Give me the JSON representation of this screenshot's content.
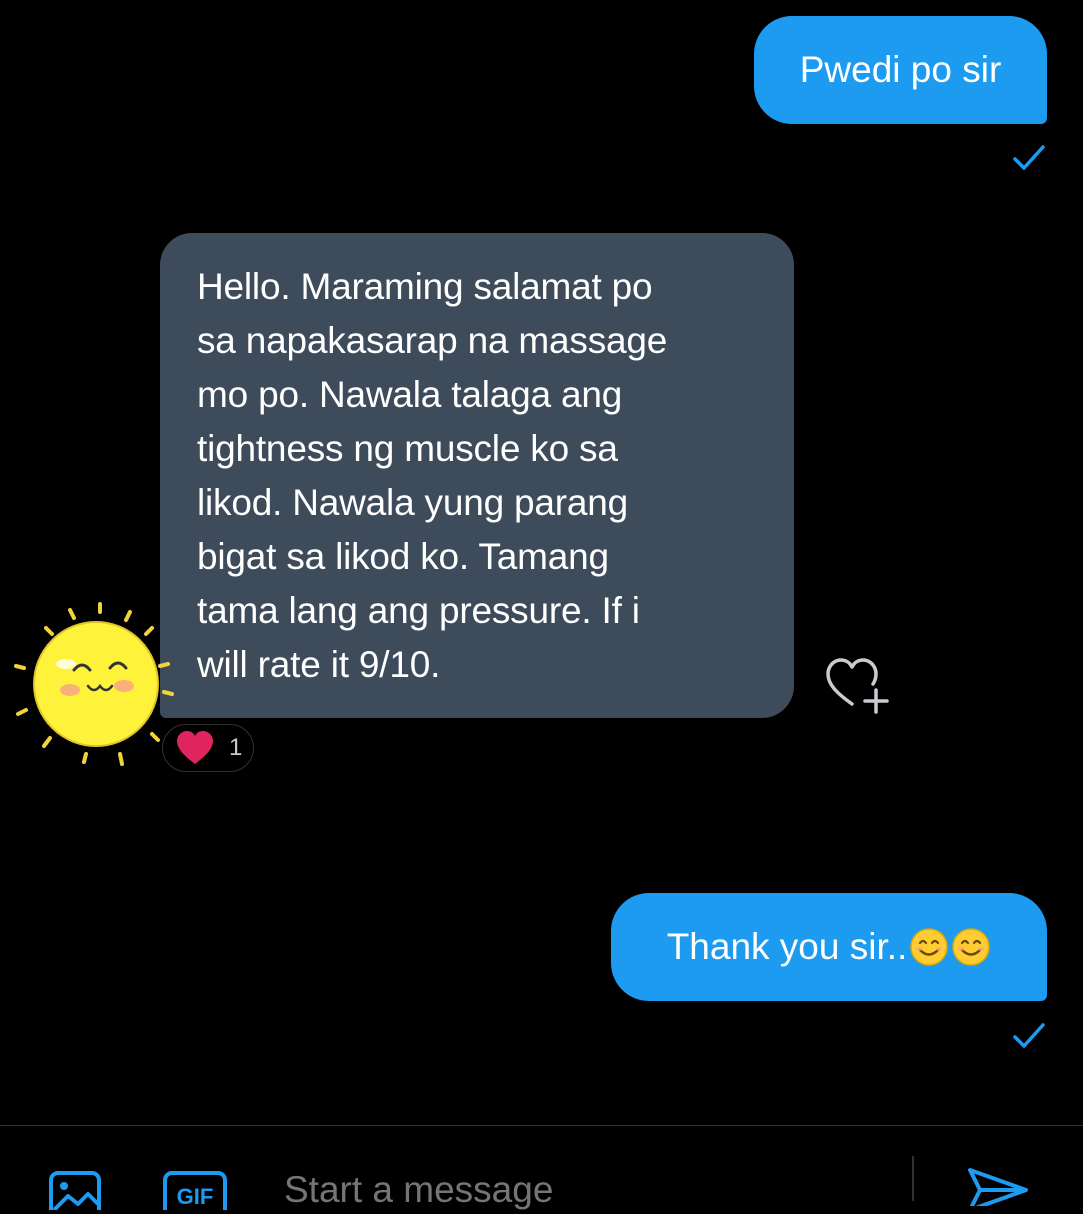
{
  "messages": [
    {
      "direction": "outgoing",
      "text": "Pwedi po sir",
      "status": "sent"
    },
    {
      "direction": "incoming",
      "text": "Hello. Maraming salamat po\nsa napakasarap na massage\nmo po. Nawala talaga ang\ntightness ng muscle ko sa\nlikod. Nawala yung parang\nbigat sa likod ko. Tamang\ntama lang ang pressure. If i\nwill rate it 9/10.",
      "reaction": {
        "icon": "heart-icon",
        "count": "1"
      }
    },
    {
      "direction": "outgoing",
      "text": "Thank you sir..",
      "emojis": [
        "smiling-face-icon",
        "smiling-face-icon"
      ],
      "status": "sent"
    }
  ],
  "composer": {
    "placeholder": "Start a message",
    "icons": [
      "image-icon",
      "gif-icon",
      "send-icon"
    ]
  },
  "colors": {
    "background": "#000000",
    "outgoing_bubble": "#1d9bf0",
    "incoming_bubble": "#3d4b5a",
    "accent": "#1d9bf0"
  }
}
